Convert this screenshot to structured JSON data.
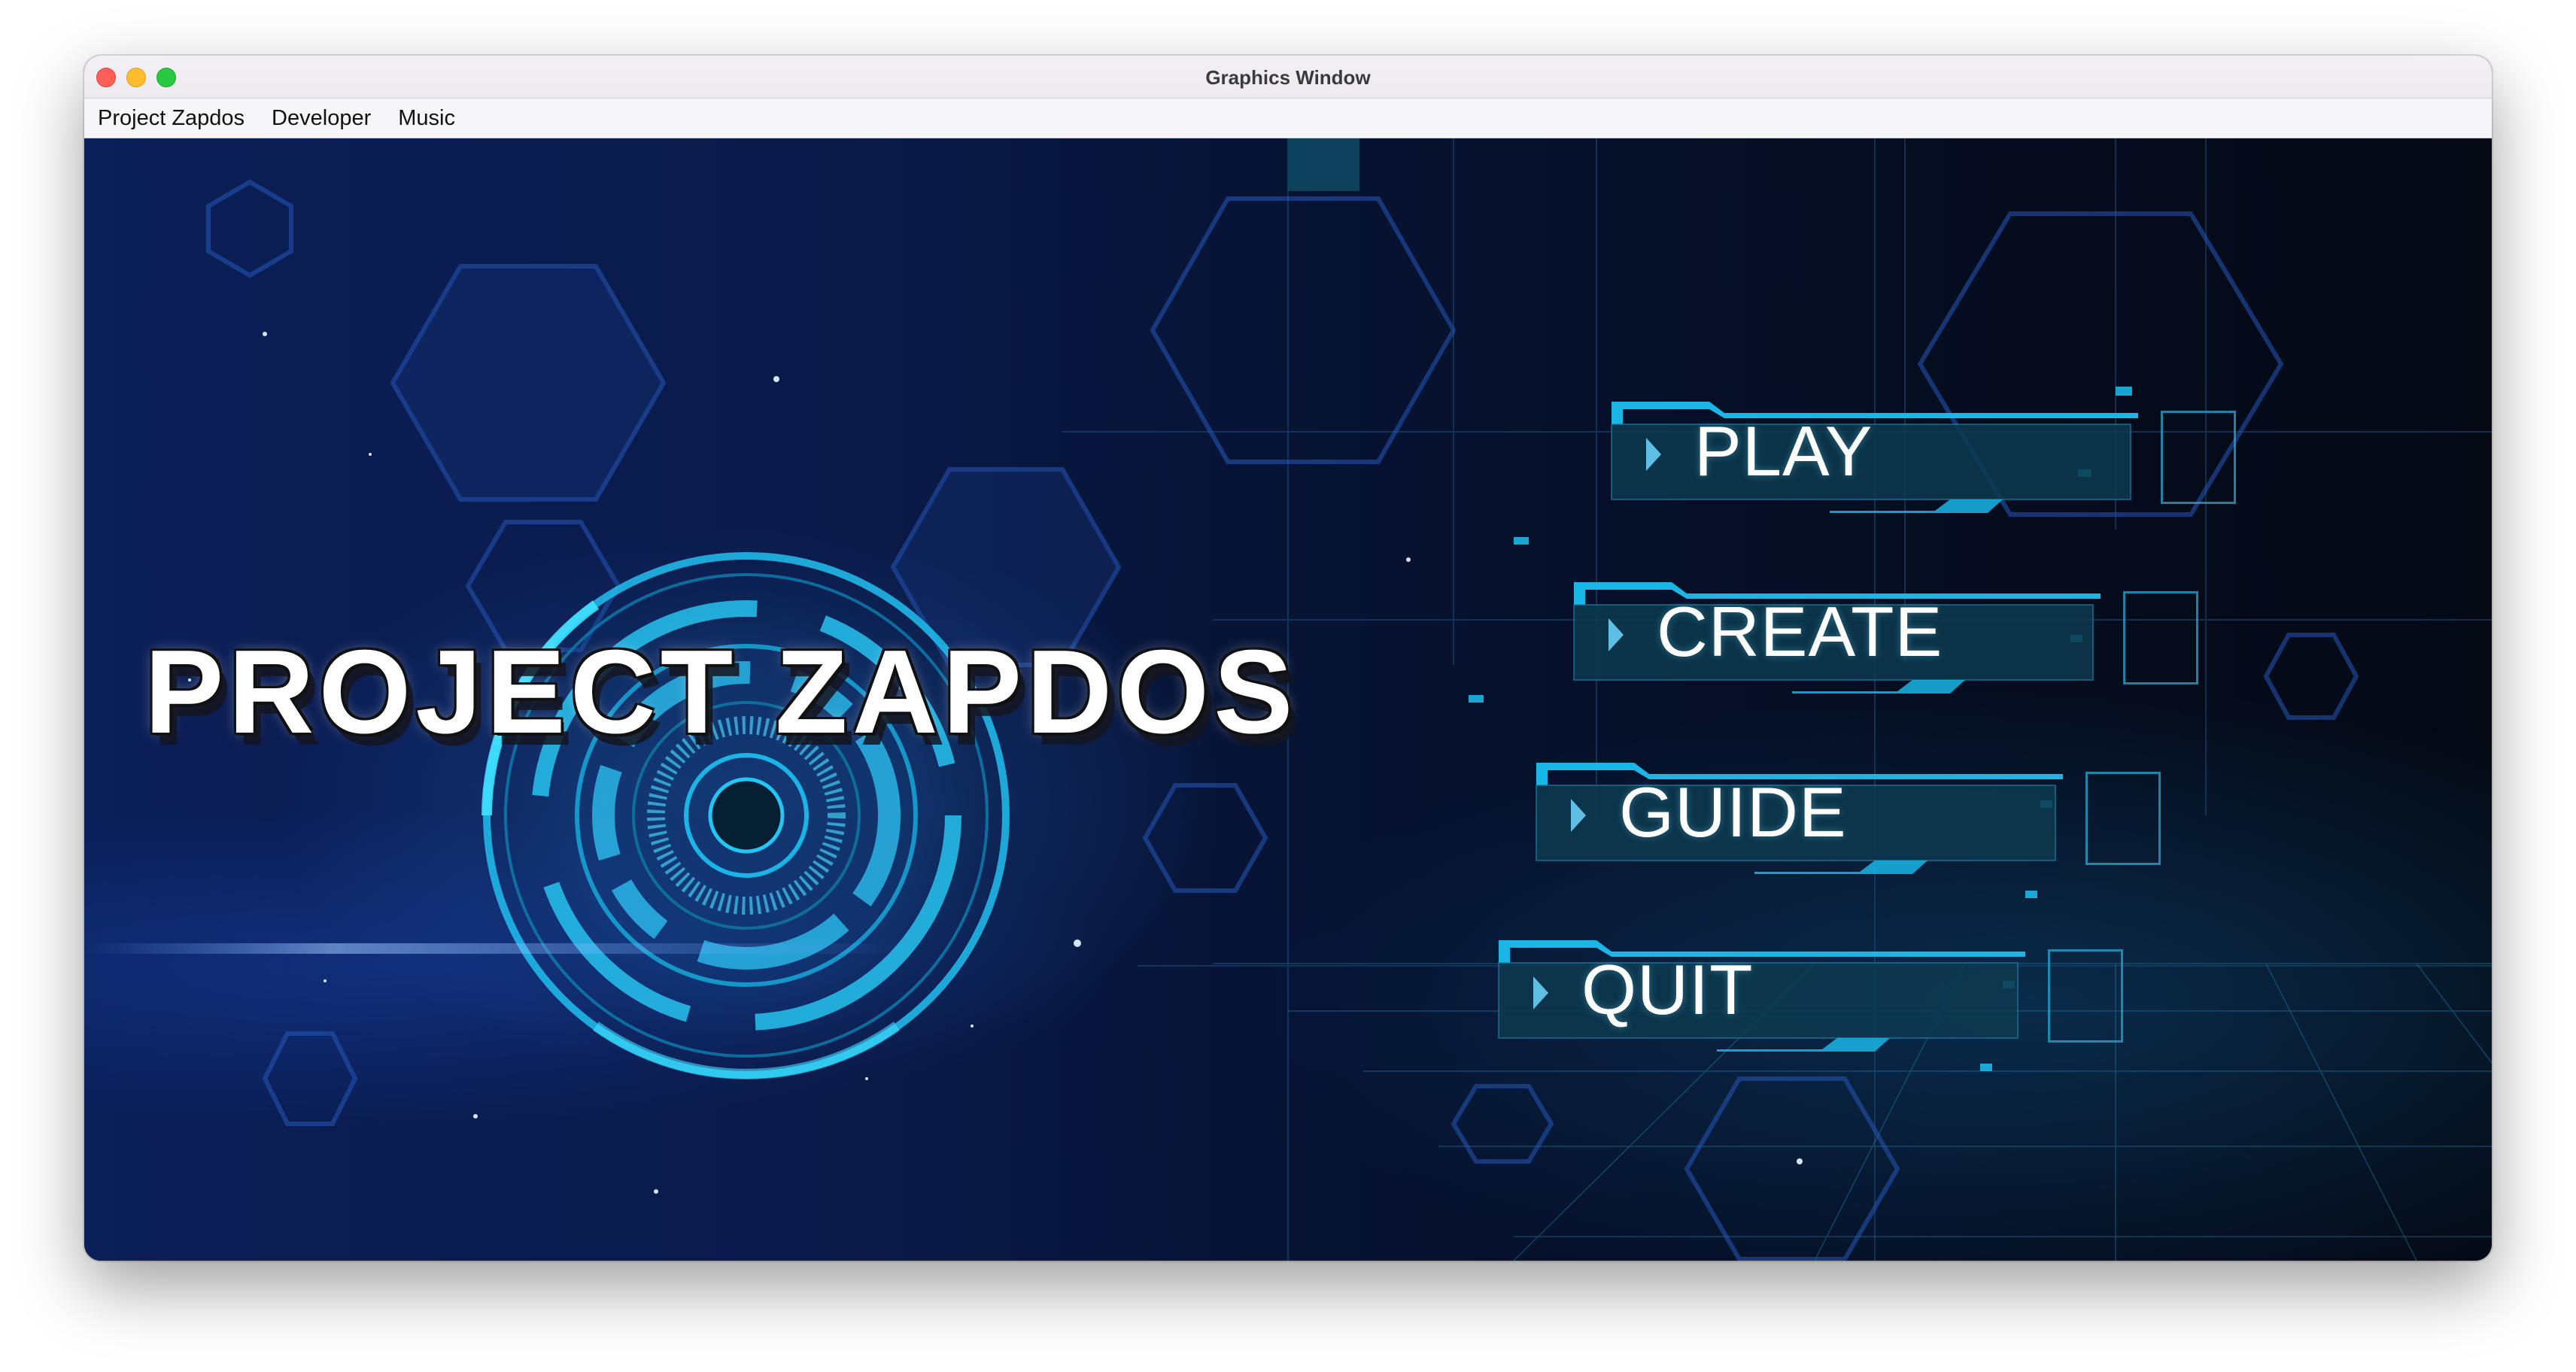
{
  "window": {
    "title": "Graphics Window"
  },
  "menubar": {
    "items": [
      "Project Zapdos",
      "Developer",
      "Music"
    ]
  },
  "game": {
    "logo_text": "PROJECT ZAPDOS",
    "buttons": [
      {
        "label": "PLAY",
        "icon": "play-arrow-icon"
      },
      {
        "label": "CREATE",
        "icon": "play-arrow-icon"
      },
      {
        "label": "GUIDE",
        "icon": "play-arrow-icon"
      },
      {
        "label": "QUIT",
        "icon": "play-arrow-icon"
      }
    ]
  },
  "colors": {
    "accent_cyan": "#19b6e6",
    "button_fill": "#0d3a4f",
    "background_dark": "#050c1e",
    "background_blue": "#0b1f58",
    "close": "#fe5f57",
    "minimize": "#febc2e",
    "maximize": "#28c840"
  }
}
